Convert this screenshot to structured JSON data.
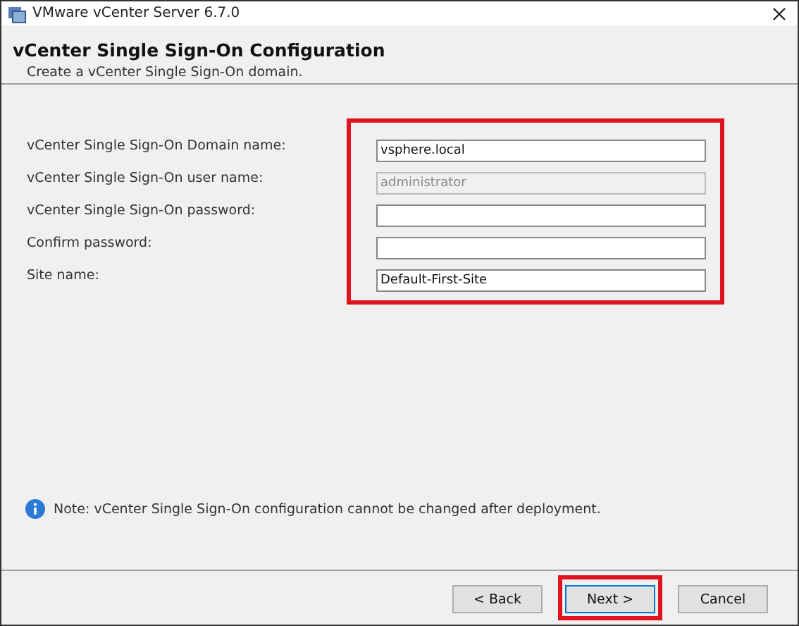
{
  "window": {
    "title": "VMware vCenter Server 6.7.0"
  },
  "header": {
    "title": "vCenter Single Sign-On Configuration",
    "subtitle": "Create a vCenter Single Sign-On domain."
  },
  "form": {
    "highlighted": true,
    "fields": [
      {
        "label": "vCenter Single Sign-On Domain name:",
        "value": "vsphere.local",
        "disabled": false
      },
      {
        "label": "vCenter Single Sign-On user name:",
        "value": "administrator",
        "disabled": true
      },
      {
        "label": "vCenter Single Sign-On password:",
        "disabled": false
      },
      {
        "label": "Confirm password:",
        "disabled": false
      },
      {
        "label": "Site name:",
        "value": "Default-First-Site",
        "disabled": false
      }
    ]
  },
  "note": "Note: vCenter Single Sign-On configuration cannot be changed after deployment.",
  "buttons": [
    {
      "label": "< Back",
      "default": false,
      "highlighted": false
    },
    {
      "label": "Next >",
      "default": true,
      "highlighted": true
    },
    {
      "label": "Cancel",
      "default": false,
      "highlighted": false
    }
  ]
}
